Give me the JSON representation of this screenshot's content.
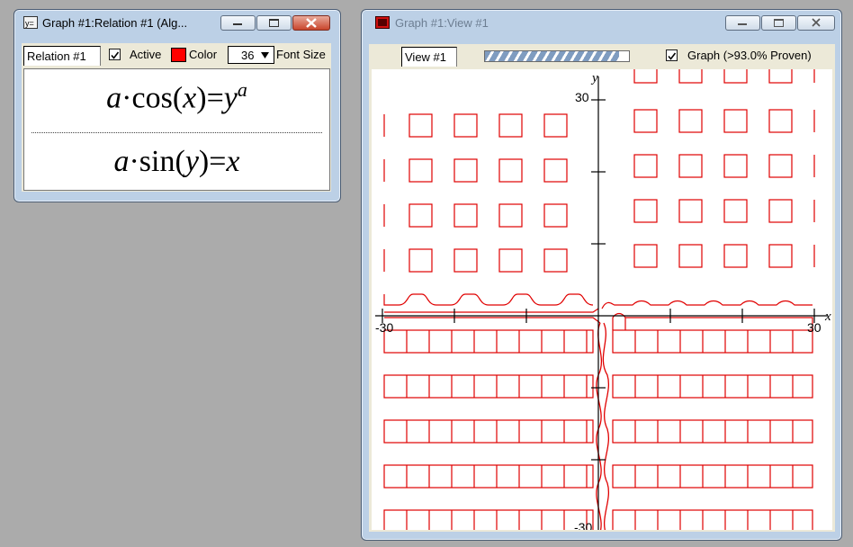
{
  "relation_window": {
    "title": "Graph #1:Relation #1 (Alg...",
    "tab_label": "Relation #1",
    "active_label": "Active",
    "active_checked": true,
    "color_label": "Color",
    "color_value": "#ff0000",
    "font_size_value": "36",
    "font_size_label": "Font Size",
    "equations": [
      {
        "lhs_coef": "a",
        "op": "·",
        "func": "cos",
        "arg": "x",
        "eq": "=",
        "rhs_base": "y",
        "rhs_exp": "a"
      },
      {
        "lhs_coef": "a",
        "op": "·",
        "func": "sin",
        "arg": "y",
        "eq": "=",
        "rhs_base": "x",
        "rhs_exp": ""
      }
    ]
  },
  "graph_window": {
    "title": "Graph #1:View #1",
    "tab_label": "View #1",
    "graph_label": "Graph (>93.0% Proven)",
    "graph_checked": true,
    "proven_fraction": 0.93
  },
  "plot": {
    "x_axis_label": "x",
    "y_axis_label": "y",
    "x_min_label": "-30",
    "x_max_label": "30",
    "y_min_label": "-30",
    "y_max_label": "30",
    "curve_color": "#e00000",
    "axis_color": "#000000"
  }
}
